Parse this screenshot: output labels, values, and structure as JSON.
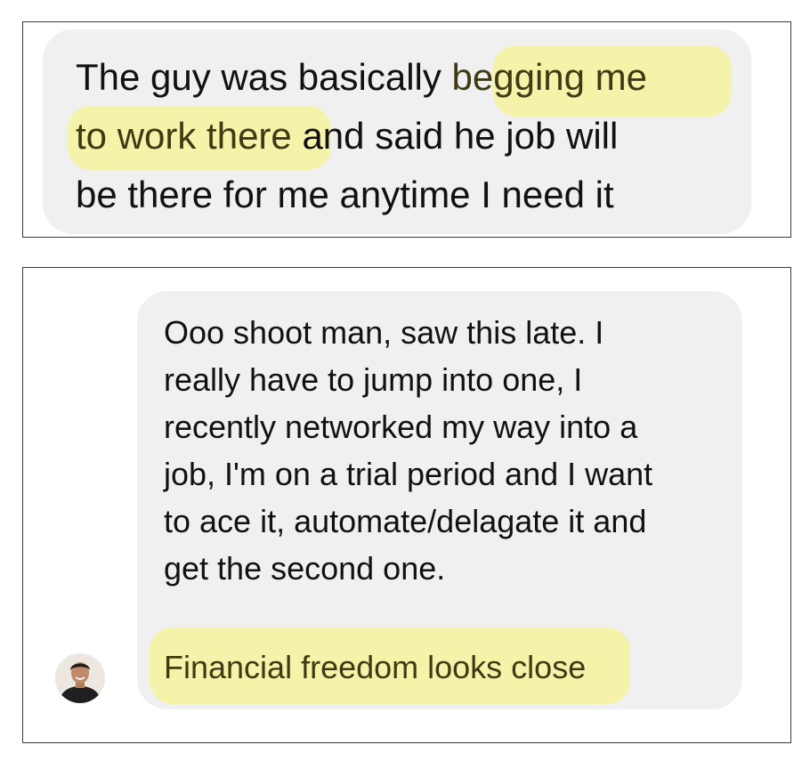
{
  "message_1": {
    "lines": [
      [
        "The guy was basically ",
        "begging me"
      ],
      [
        "to work there",
        " and said he job will"
      ],
      [
        "be there for me anytime I need it"
      ]
    ]
  },
  "message_2": {
    "lines": [
      "Ooo shoot man, saw this late. I",
      "really have to jump into one, I",
      "recently networked my way into a",
      "job, I'm on a trial period and I want",
      "to ace it, automate/delagate it and",
      "get the second one."
    ],
    "closing_line": "Financial freedom looks close"
  },
  "colors": {
    "bubble_bg": "#f0f0f0",
    "highlight": "#f6f39c",
    "text": "#111111"
  }
}
